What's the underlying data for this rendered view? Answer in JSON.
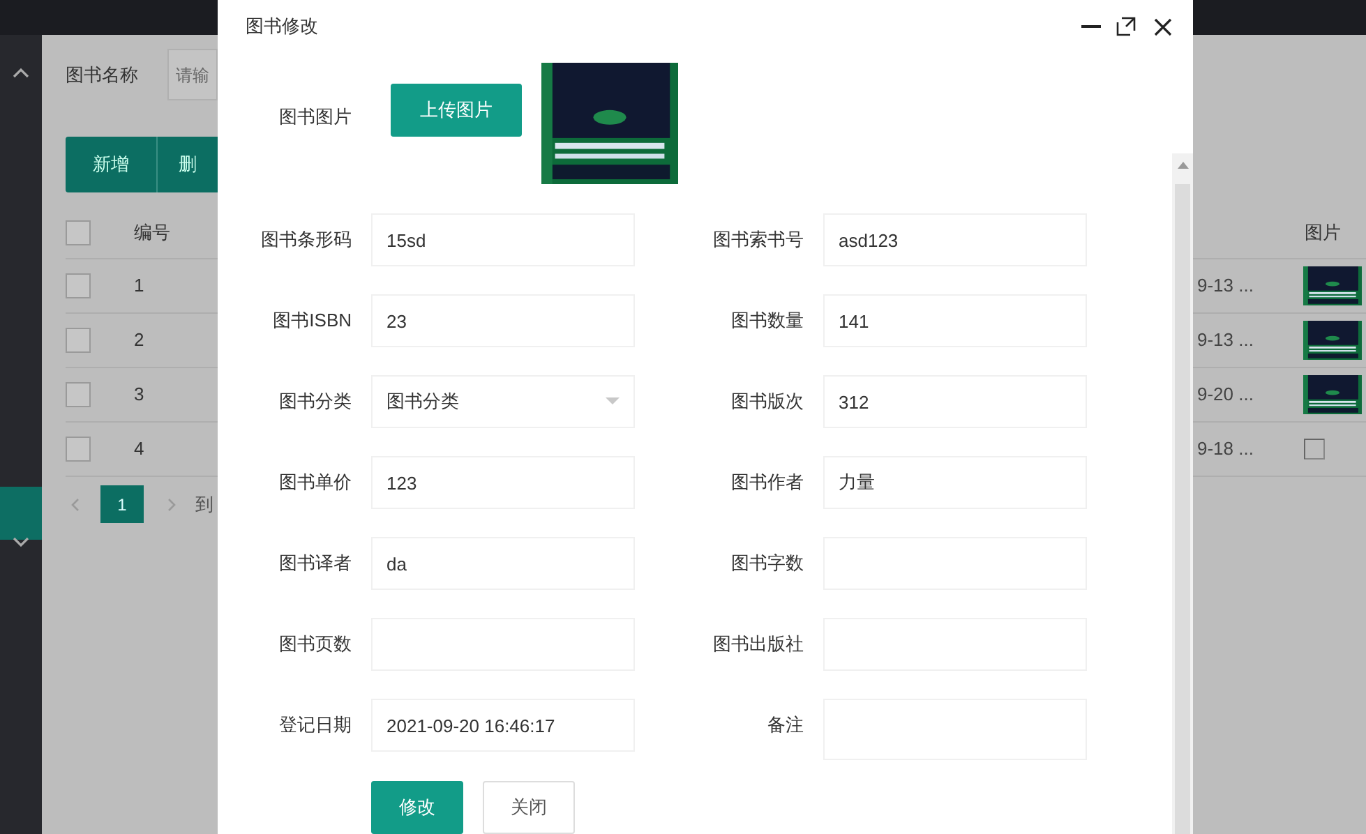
{
  "sidebar": {
    "items": [
      {
        "selected": true
      }
    ]
  },
  "search": {
    "label": "图书名称",
    "placeholder": "请输"
  },
  "toolbar": [
    "新增",
    "删"
  ],
  "table": {
    "header_checked": false,
    "columns": [
      "编号",
      "图片"
    ],
    "rows": [
      {
        "checked": false,
        "id": "1",
        "date": "9-13 ...",
        "kind": "picture"
      },
      {
        "checked": false,
        "id": "2",
        "date": "9-13 ...",
        "kind": "picture"
      },
      {
        "checked": false,
        "id": "3",
        "date": "9-20 ...",
        "kind": "picture"
      },
      {
        "checked": false,
        "id": "4",
        "date": "9-18 ...",
        "kind": "broken"
      }
    ]
  },
  "pagination": {
    "pages": [
      {
        "label": "1",
        "selected": true
      }
    ],
    "jump_label": "到"
  },
  "dialog": {
    "title": "图书修改",
    "image_field": {
      "label": "图书图片",
      "button": "上传图片"
    },
    "fields": [
      {
        "label": "图书条形码",
        "value": "15sd",
        "kind": "text"
      },
      {
        "label": "图书索书号",
        "value": "asd123",
        "kind": "text"
      },
      {
        "label": "图书ISBN",
        "value": "23",
        "kind": "text"
      },
      {
        "label": "图书数量",
        "value": "141",
        "kind": "text"
      },
      {
        "label": "图书分类",
        "value": "图书分类",
        "kind": "select"
      },
      {
        "label": "图书版次",
        "value": "312",
        "kind": "text"
      },
      {
        "label": "图书单价",
        "value": "123",
        "kind": "text"
      },
      {
        "label": "图书作者",
        "value": "力量",
        "kind": "text"
      },
      {
        "label": "图书译者",
        "value": "da",
        "kind": "text"
      },
      {
        "label": "图书字数",
        "kind": "text"
      },
      {
        "label": "图书页数",
        "kind": "text"
      },
      {
        "label": "图书出版社",
        "kind": "text"
      },
      {
        "label": "登记日期",
        "value": "2021-09-20 16:46:17",
        "kind": "text"
      },
      {
        "label": "备注",
        "kind": "textarea"
      }
    ],
    "buttons": [
      {
        "label": "修改",
        "kind": "primary"
      },
      {
        "label": "关闭",
        "kind": "default"
      }
    ]
  }
}
